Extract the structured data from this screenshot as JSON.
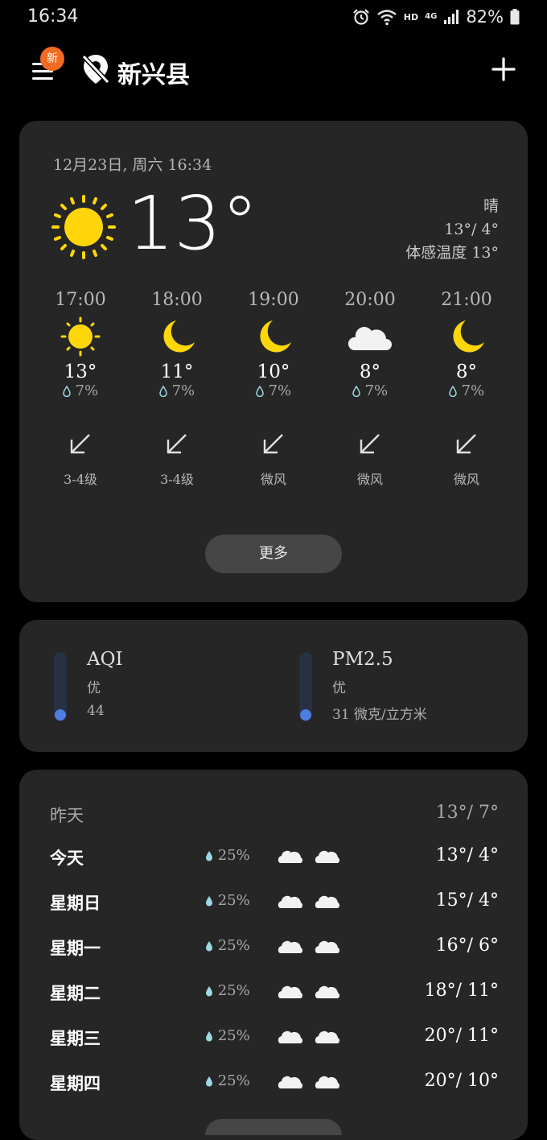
{
  "status": {
    "time": "16:34",
    "hd": "HD",
    "network": "4G",
    "battery": "82%"
  },
  "header": {
    "badge": "新",
    "city": "新兴县"
  },
  "current": {
    "date": "12月23日, 周六 16:34",
    "temp": "13°",
    "condition": "晴",
    "range": "13°/ 4°",
    "feels_like": "体感温度 13°"
  },
  "hourly": [
    {
      "time": "17:00",
      "icon": "sun-icon",
      "temp": "13°",
      "rain": "7%",
      "wind": "3-4级"
    },
    {
      "time": "18:00",
      "icon": "moon-icon",
      "temp": "11°",
      "rain": "7%",
      "wind": "3-4级"
    },
    {
      "time": "19:00",
      "icon": "moon-icon",
      "temp": "10°",
      "rain": "7%",
      "wind": "微风"
    },
    {
      "time": "20:00",
      "icon": "cloud-icon",
      "temp": "8°",
      "rain": "7%",
      "wind": "微风"
    },
    {
      "time": "21:00",
      "icon": "moon-icon",
      "temp": "8°",
      "rain": "7%",
      "wind": "微风"
    }
  ],
  "more_label": "更多",
  "air": {
    "aqi": {
      "title": "AQI",
      "level": "优",
      "value": "44"
    },
    "pm25": {
      "title": "PM2.5",
      "level": "优",
      "value": "31 微克/立方米"
    }
  },
  "forecast": {
    "yesterday": {
      "day": "昨天",
      "temp": "13°/ 7°"
    },
    "days": [
      {
        "day": "今天",
        "rain": "25%",
        "temp": "13°/ 4°"
      },
      {
        "day": "星期日",
        "rain": "25%",
        "temp": "15°/ 4°"
      },
      {
        "day": "星期一",
        "rain": "25%",
        "temp": "16°/ 6°"
      },
      {
        "day": "星期二",
        "rain": "25%",
        "temp": "18°/ 11°"
      },
      {
        "day": "星期三",
        "rain": "25%",
        "temp": "20°/ 11°"
      },
      {
        "day": "星期四",
        "rain": "25%",
        "temp": "20°/ 10°"
      }
    ]
  },
  "colors": {
    "background": "#000000",
    "card": "#262626",
    "sun": "#ffd60a",
    "badge": "#f36a21",
    "gauge_fill": "#4f7cdf"
  }
}
